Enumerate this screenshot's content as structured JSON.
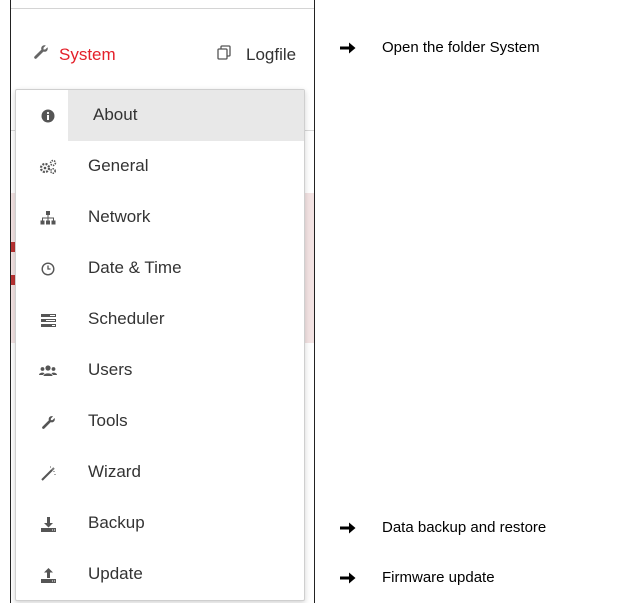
{
  "tabs": {
    "system": {
      "label": "System",
      "icon": "wrench-icon",
      "color": "#e4202a"
    },
    "logfiles": {
      "label": "Logfile",
      "icon": "copy-icon"
    }
  },
  "menu": {
    "items": [
      {
        "label": "About",
        "icon": "info-icon",
        "highlighted": true
      },
      {
        "label": "General",
        "icon": "gears-icon"
      },
      {
        "label": "Network",
        "icon": "sitemap-icon"
      },
      {
        "label": "Date & Time",
        "icon": "clock-icon"
      },
      {
        "label": "Scheduler",
        "icon": "tasks-icon"
      },
      {
        "label": "Users",
        "icon": "users-icon"
      },
      {
        "label": "Tools",
        "icon": "wrench-icon"
      },
      {
        "label": "Wizard",
        "icon": "magic-icon"
      },
      {
        "label": "Backup",
        "icon": "download-icon"
      },
      {
        "label": "Update",
        "icon": "upload-icon"
      }
    ]
  },
  "annotations": {
    "open_folder": "Open the folder System",
    "backup": "Data backup and restore",
    "firmware": "Firmware update"
  }
}
